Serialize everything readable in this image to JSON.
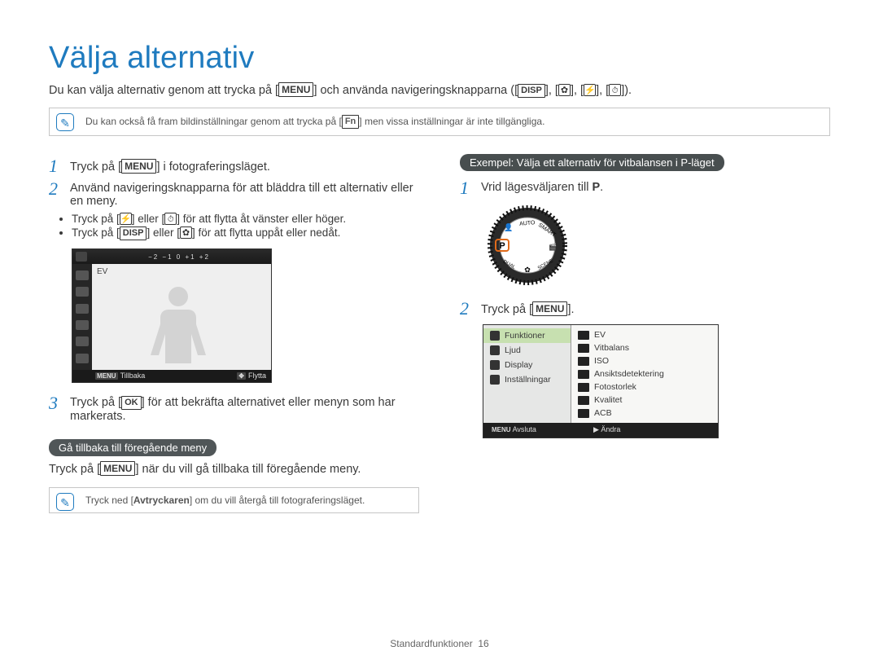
{
  "title": "Välja alternativ",
  "intro": {
    "pre": "Du kan välja alternativ genom att trycka på [",
    "menu_label": "MENU",
    "mid": "] och använda navigeringsknapparna ([",
    "disp_label": "DISP",
    "tail": "]).",
    "seg_after_disp": "], [",
    "seg_comma": "], [",
    "seg_close": "], ["
  },
  "note1": {
    "pre": "Du kan också få fram bildinställningar genom att trycka på [",
    "fn": "Fn",
    "post": "] men vissa inställningar är inte tillgängliga."
  },
  "left": {
    "step1": {
      "pre": "Tryck på [",
      "menu": "MENU",
      "post": "] i fotograferingsläget."
    },
    "step2": "Använd navigeringsknapparna för att bläddra till ett alternativ eller en meny.",
    "bullets": {
      "b1_pre": "Tryck på [",
      "b1_mid": "] eller [",
      "b1_post": "] för att flytta åt vänster eller höger.",
      "b2_pre": "Tryck på [",
      "b2_disp": "DISP",
      "b2_mid": "] eller [",
      "b2_post": "] för att flytta uppåt eller nedåt."
    },
    "lcd": {
      "ev": "EV",
      "scale": "−2   −1   0   +1   +2",
      "footer_back_key": "MENU",
      "footer_back": "Tillbaka",
      "footer_move": "Flytta"
    },
    "step3": {
      "pre": "Tryck på [",
      "ok": "OK",
      "post": "] för att bekräfta alternativet eller menyn som har markerats."
    },
    "back_pill": "Gå tillbaka till föregående meny",
    "back_line": {
      "pre": "Tryck på [",
      "menu": "MENU",
      "post": "] när du vill gå tillbaka till föregående meny."
    },
    "note2": {
      "pre": "Tryck ned [",
      "shutter": "Avtryckaren",
      "post": "] om du vill återgå till fotograferingsläget."
    }
  },
  "right": {
    "pill": "Exempel: Välja ett alternativ för vitbalansen i P-läget",
    "step1": {
      "pre": "Vrid lägesväljaren till ",
      "mode": "P",
      "post": "."
    },
    "step2": {
      "pre": "Tryck på [",
      "menu": "MENU",
      "post": "]."
    },
    "menu_left": [
      "Funktioner",
      "Ljud",
      "Display",
      "Inställningar"
    ],
    "menu_right": [
      "EV",
      "Vitbalans",
      "ISO",
      "Ansiktsdetektering",
      "Fotostorlek",
      "Kvalitet",
      "ACB"
    ],
    "menu_footer": {
      "exit_key": "MENU",
      "exit": "Avsluta",
      "change_sym": "▶",
      "change": "Ändra"
    }
  },
  "footer": {
    "section": "Standardfunktioner",
    "page": "16"
  }
}
